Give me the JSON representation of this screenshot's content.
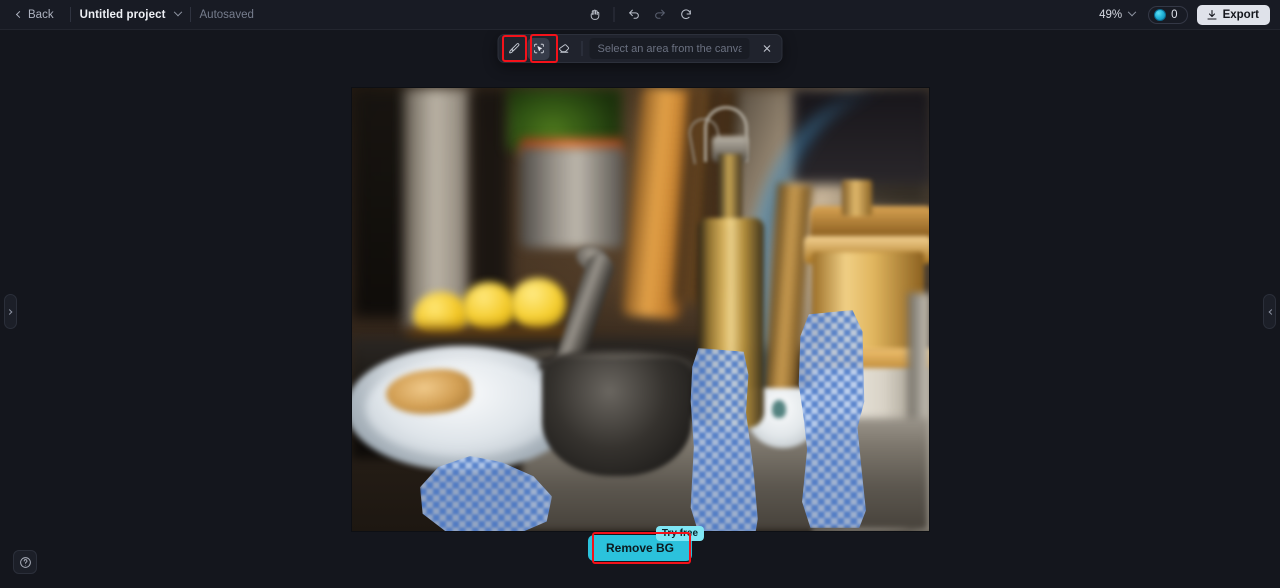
{
  "topbar": {
    "back_label": "Back",
    "project_name": "Untitled project",
    "project_caret_icon": "chevron-down-icon",
    "autosaved_label": "Autosaved",
    "center_tools": [
      {
        "icon": "pan-hand-icon",
        "name": "pan-tool"
      },
      {
        "icon": "undo-icon",
        "name": "undo"
      },
      {
        "icon": "redo-icon",
        "name": "redo"
      },
      {
        "icon": "reset-icon",
        "name": "reset"
      }
    ],
    "zoom_level": "49%",
    "zoom_caret_icon": "chevron-down-icon",
    "credits_icon": "credit-coin-icon",
    "credits_count": "0",
    "export_icon": "download-icon",
    "export_label": "Export"
  },
  "toolpanel": {
    "tools": [
      {
        "name": "brush-tool",
        "icon": "brush-icon",
        "selected": false,
        "highlighted": true
      },
      {
        "name": "magic-select-tool",
        "icon": "magic-select-icon",
        "selected": true,
        "highlighted": true
      },
      {
        "name": "eraser-tool",
        "icon": "eraser-icon",
        "selected": false,
        "highlighted": false
      }
    ],
    "search_placeholder": "Select an area from the canvas",
    "search_value": "",
    "close_icon": "close-icon"
  },
  "canvas": {
    "image_alt": "Blurred kitchen counter scene with lemons, mortar and pestle, oil bottle and wooden jars",
    "selection_masks": [
      {
        "name": "mask-left-shaker"
      },
      {
        "name": "mask-right-shaker"
      },
      {
        "name": "mask-cloth"
      }
    ]
  },
  "cta": {
    "label": "Remove BG",
    "badge": "Try free"
  },
  "panels": {
    "left_handle_icon": "chevron-right-icon",
    "right_handle_icon": "chevron-left-icon",
    "help_icon": "help-circle-icon"
  },
  "colors": {
    "accent": "#2bc2dc",
    "badge": "#7fe6f5",
    "annotation": "#f4121a",
    "topbar_bg": "#181b24",
    "app_bg": "#14161d",
    "mask_blue": "#3a6cc4"
  }
}
